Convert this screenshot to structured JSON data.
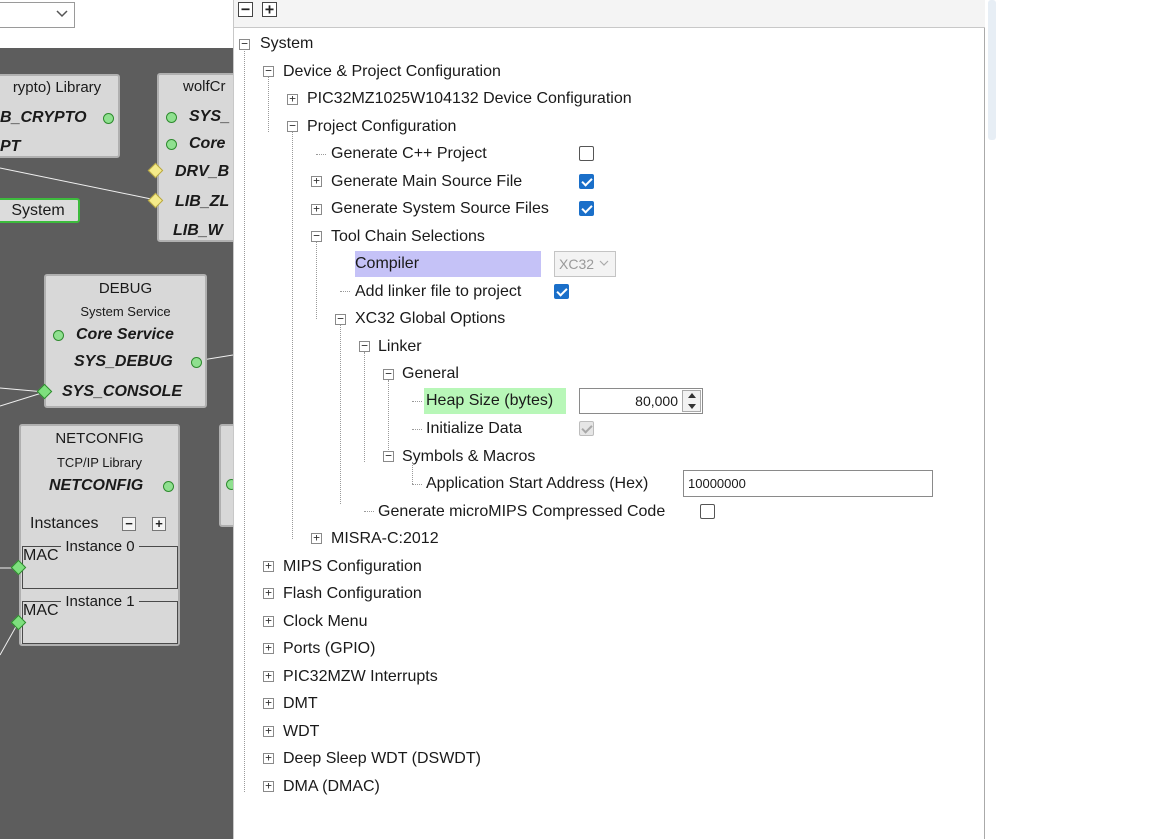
{
  "graph": {
    "system_button": "System",
    "nodes": {
      "crypto": {
        "title": "rypto) Library",
        "ports": [
          "B_CRYPTO",
          "PT"
        ]
      },
      "wolf": {
        "title": "wolfCr",
        "ports": [
          "SYS_",
          "Core",
          "DRV_B",
          "LIB_ZL",
          "LIB_W"
        ]
      },
      "debug": {
        "title": "DEBUG",
        "subtitle": "System Service",
        "ports": [
          "Core Service",
          "SYS_DEBUG",
          "SYS_CONSOLE"
        ]
      },
      "netconfig": {
        "title": "NETCONFIG",
        "subtitle": "TCP/IP Library",
        "ports": [
          "NETCONFIG"
        ],
        "instances_label": "Instances",
        "instances": [
          {
            "label": "Instance 0",
            "port": "MAC"
          },
          {
            "label": "Instance 1",
            "port": "MAC"
          }
        ]
      }
    }
  },
  "tree": {
    "toolbar": {
      "collapse": "−",
      "expand": "+"
    },
    "items": [
      {
        "label": "System",
        "expander": "−"
      },
      {
        "label": "Device & Project Configuration",
        "expander": "−"
      },
      {
        "label": "PIC32MZ1025W104132 Device Configuration",
        "expander": "+"
      },
      {
        "label": "Project Configuration",
        "expander": "−"
      },
      {
        "label": "Generate C++ Project",
        "checked": false
      },
      {
        "label": "Generate Main Source File",
        "expander": "+",
        "checked": true
      },
      {
        "label": "Generate System Source Files",
        "expander": "+",
        "checked": true
      },
      {
        "label": "Tool Chain Selections",
        "expander": "−"
      },
      {
        "label": "Compiler",
        "value": "XC32"
      },
      {
        "label": "Add linker file to project",
        "checked": true
      },
      {
        "label": "XC32 Global Options",
        "expander": "−"
      },
      {
        "label": "Linker",
        "expander": "−"
      },
      {
        "label": "General",
        "expander": "−"
      },
      {
        "label": "Heap Size (bytes)",
        "value": "80,000"
      },
      {
        "label": "Initialize Data",
        "checked": true,
        "disabled": true
      },
      {
        "label": "Symbols & Macros",
        "expander": "−"
      },
      {
        "label": "Application Start Address (Hex)",
        "value": "10000000"
      },
      {
        "label": "Generate microMIPS Compressed Code",
        "checked": false
      },
      {
        "label": "MISRA-C:2012",
        "expander": "+"
      },
      {
        "label": "MIPS Configuration",
        "expander": "+"
      },
      {
        "label": "Flash Configuration",
        "expander": "+"
      },
      {
        "label": "Clock Menu",
        "expander": "+"
      },
      {
        "label": "Ports (GPIO)",
        "expander": "+"
      },
      {
        "label": "PIC32MZW Interrupts",
        "expander": "+"
      },
      {
        "label": "DMT",
        "expander": "+"
      },
      {
        "label": "WDT",
        "expander": "+"
      },
      {
        "label": "Deep Sleep WDT (DSWDT)",
        "expander": "+"
      },
      {
        "label": "DMA (DMAC)",
        "expander": "+"
      }
    ]
  },
  "colors": {
    "canvas": "#5d5d5d",
    "node": "#d8d8d8",
    "compiler_highlight": "#c5c2f7",
    "heap_highlight": "#b8f7b8",
    "checkbox_on": "#1a6fc9"
  }
}
